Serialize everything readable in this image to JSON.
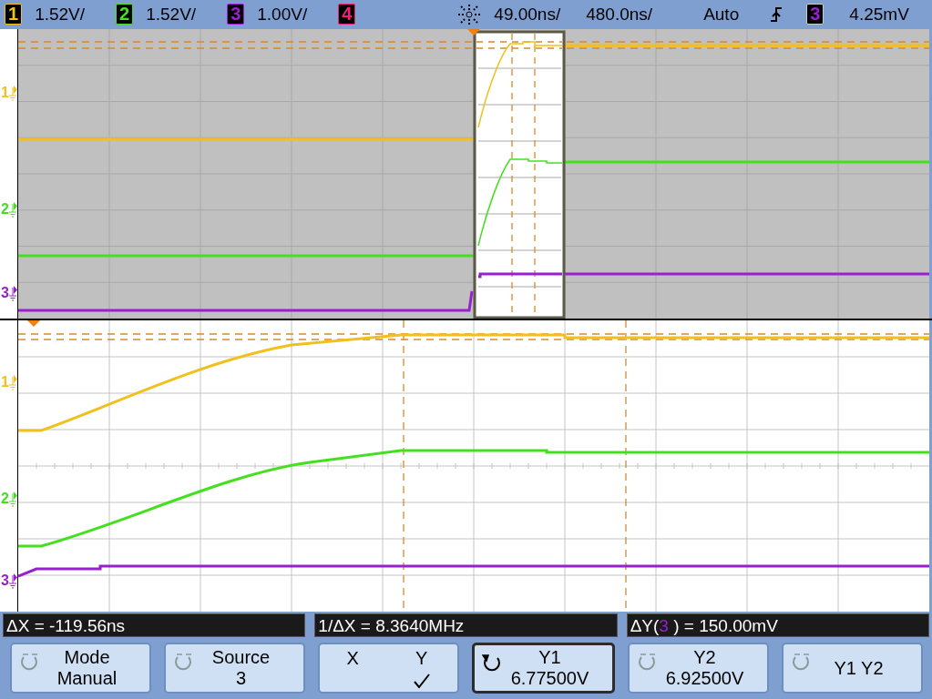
{
  "channels": [
    {
      "number": "1",
      "scale": "1.52V/",
      "color": "#f2c01c"
    },
    {
      "number": "2",
      "scale": "1.52V/",
      "color": "#44e020"
    },
    {
      "number": "3",
      "scale": "1.00V/",
      "color": "#9a1fd0"
    },
    {
      "number": "4",
      "color": "#f0207a"
    }
  ],
  "timebase": {
    "delay": "49.00ns/",
    "scale": "480.0ns/"
  },
  "trigger": {
    "mode": "Auto",
    "source": "3",
    "level": "4.25mV"
  },
  "upper_plot": {
    "markers": [
      {
        "label": "1",
        "color": "#f2c01c"
      },
      {
        "label": "2",
        "color": "#44e020"
      },
      {
        "label": "3",
        "color": "#9a1fd0"
      }
    ]
  },
  "lower_plot": {
    "markers": [
      {
        "label": "1",
        "color": "#f2c01c"
      },
      {
        "label": "2",
        "color": "#44e020"
      },
      {
        "label": "3",
        "color": "#9a1fd0"
      }
    ]
  },
  "readouts": [
    {
      "text": "ΔX = -119.56ns"
    },
    {
      "text": "1/ΔX = 8.3640MHz"
    },
    {
      "prefix": "ΔY(",
      "source": "3",
      "suffix": " ) = 150.00mV"
    }
  ],
  "softkeys": [
    {
      "kind": "knob",
      "label": "Mode",
      "value": "Manual",
      "active": false
    },
    {
      "kind": "knob",
      "label": "Source",
      "value": "3",
      "active": false
    },
    {
      "kind": "toggle",
      "options": [
        {
          "label": "X",
          "selected": false
        },
        {
          "label": "Y",
          "selected": true
        }
      ]
    },
    {
      "kind": "knob",
      "label": "Y1",
      "value": "6.77500V",
      "active": true
    },
    {
      "kind": "knob",
      "label": "Y2",
      "value": "6.92500V",
      "active": false
    },
    {
      "kind": "knob",
      "label": "Y1 Y2",
      "active": false
    }
  ]
}
